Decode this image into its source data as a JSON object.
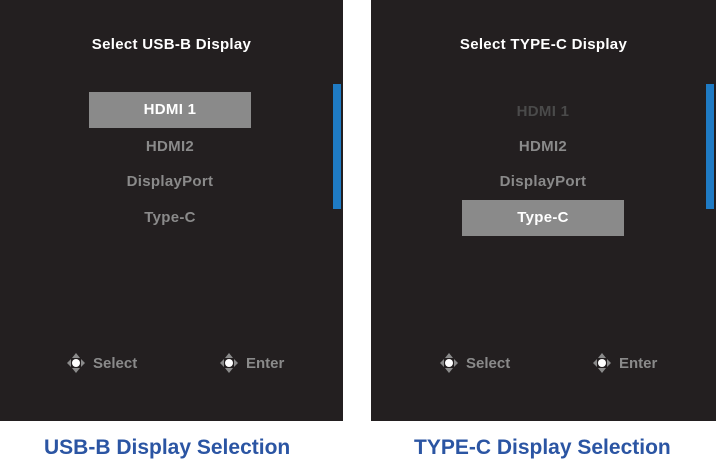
{
  "panels": [
    {
      "title": "Select USB-B Display",
      "items": [
        "HDMI 1",
        "HDMI2",
        "DisplayPort",
        "Type-C"
      ],
      "selected_index": 0,
      "hints": {
        "select": "Select",
        "enter": "Enter"
      },
      "caption": "USB-B Display Selection"
    },
    {
      "title": "Select TYPE-C Display",
      "items": [
        "HDMI 1",
        "HDMI2",
        "DisplayPort",
        "Type-C"
      ],
      "selected_index": 3,
      "disabled_index": 0,
      "hints": {
        "select": "Select",
        "enter": "Enter"
      },
      "caption": "TYPE-C Display Selection"
    }
  ],
  "colors": {
    "panel_bg": "#231f20",
    "scrollbar": "#1f7bc4",
    "selected_bg": "#8a8a8a",
    "caption": "#2b55a3"
  }
}
